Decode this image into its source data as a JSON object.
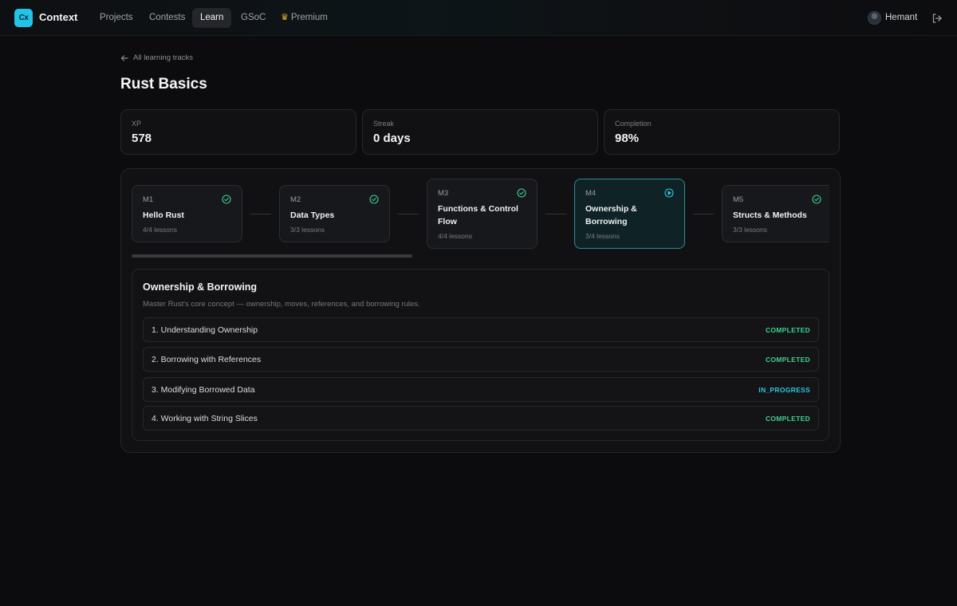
{
  "nav": {
    "logo_text": "Cx",
    "brand": "Context",
    "links": [
      "Projects",
      "Contests",
      "Learn",
      "GSoC",
      "Premium"
    ],
    "active": "Learn",
    "user": "Hemant"
  },
  "page": {
    "back_label": "All learning tracks",
    "title": "Rust Basics"
  },
  "stats": [
    {
      "label": "XP",
      "value": "578"
    },
    {
      "label": "Streak",
      "value": "0 days"
    },
    {
      "label": "Completion",
      "value": "98%"
    }
  ],
  "modules": [
    {
      "code": "M1",
      "title": "Hello Rust",
      "lessons": "4/4 lessons",
      "status": "check-circle-icon"
    },
    {
      "code": "M2",
      "title": "Data Types",
      "lessons": "3/3 lessons",
      "status": "check-circle-icon"
    },
    {
      "code": "M3",
      "title": "Functions & Control Flow",
      "lessons": "4/4 lessons",
      "status": "check-circle-icon"
    },
    {
      "code": "M4",
      "title": "Ownership & Borrowing",
      "lessons": "3/4 lessons",
      "status": "play-circle-icon"
    },
    {
      "code": "M5",
      "title": "Structs & Methods",
      "lessons": "3/3 lessons",
      "status": "check-circle-icon"
    }
  ],
  "selected_module": {
    "title": "Ownership & Borrowing",
    "description": "Master Rust's core concept — ownership, moves, references, and borrowing rules.",
    "lessons": [
      {
        "name": "1. Understanding Ownership",
        "status": "COMPLETED"
      },
      {
        "name": "2. Borrowing with References",
        "status": "COMPLETED"
      },
      {
        "name": "3. Modifying Borrowed Data",
        "status": "IN_PROGRESS"
      },
      {
        "name": "4. Working with String Slices",
        "status": "COMPLETED"
      }
    ]
  },
  "colors": {
    "accent": "#22c3e6",
    "completed": "#3fd08e",
    "in_progress": "#2fc4dc",
    "premium": "#f0b429"
  }
}
